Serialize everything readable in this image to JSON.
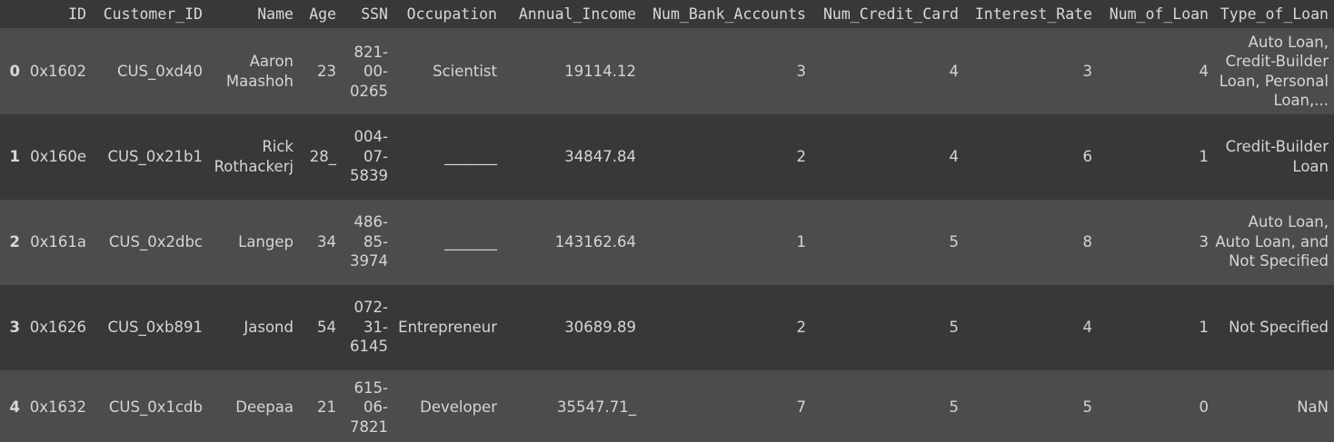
{
  "columns": [
    "",
    "ID",
    "Customer_ID",
    "Name",
    "Age",
    "SSN",
    "Occupation",
    "Annual_Income",
    "Num_Bank_Accounts",
    "Num_Credit_Card",
    "Interest_Rate",
    "Num_of_Loan",
    "Type_of_Loan"
  ],
  "rows": [
    {
      "index": "0",
      "ID": "0x1602",
      "Customer_ID": "CUS_0xd40",
      "Name": "Aaron Maashoh",
      "Age": "23",
      "SSN": "821-00-0265",
      "Occupation": "Scientist",
      "Annual_Income": "19114.12",
      "Num_Bank_Accounts": "3",
      "Num_Credit_Card": "4",
      "Interest_Rate": "3",
      "Num_of_Loan": "4",
      "Type_of_Loan": "Auto Loan, Credit-Builder Loan, Personal Loan,..."
    },
    {
      "index": "1",
      "ID": "0x160e",
      "Customer_ID": "CUS_0x21b1",
      "Name": "Rick Rothackerj",
      "Age": "28_",
      "SSN": "004-07-5839",
      "Occupation": "_______",
      "Annual_Income": "34847.84",
      "Num_Bank_Accounts": "2",
      "Num_Credit_Card": "4",
      "Interest_Rate": "6",
      "Num_of_Loan": "1",
      "Type_of_Loan": "Credit-Builder Loan"
    },
    {
      "index": "2",
      "ID": "0x161a",
      "Customer_ID": "CUS_0x2dbc",
      "Name": "Langep",
      "Age": "34",
      "SSN": "486-85-3974",
      "Occupation": "_______",
      "Annual_Income": "143162.64",
      "Num_Bank_Accounts": "1",
      "Num_Credit_Card": "5",
      "Interest_Rate": "8",
      "Num_of_Loan": "3",
      "Type_of_Loan": "Auto Loan, Auto Loan, and Not Specified"
    },
    {
      "index": "3",
      "ID": "0x1626",
      "Customer_ID": "CUS_0xb891",
      "Name": "Jasond",
      "Age": "54",
      "SSN": "072-31-6145",
      "Occupation": "Entrepreneur",
      "Annual_Income": "30689.89",
      "Num_Bank_Accounts": "2",
      "Num_Credit_Card": "5",
      "Interest_Rate": "4",
      "Num_of_Loan": "1",
      "Type_of_Loan": "Not Specified"
    },
    {
      "index": "4",
      "ID": "0x1632",
      "Customer_ID": "CUS_0x1cdb",
      "Name": "Deepaa",
      "Age": "21",
      "SSN": "615-06-7821",
      "Occupation": "Developer",
      "Annual_Income": "35547.71_",
      "Num_Bank_Accounts": "7",
      "Num_Credit_Card": "5",
      "Interest_Rate": "5",
      "Num_of_Loan": "0",
      "Type_of_Loan": "NaN"
    }
  ]
}
